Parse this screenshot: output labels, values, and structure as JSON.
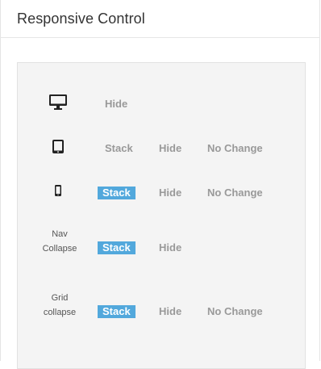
{
  "header": {
    "title": "Responsive Control"
  },
  "colors": {
    "active_option": "#52a8dc",
    "inactive_option_text": "#999999",
    "panel_background": "#f4f4f4",
    "icon": "#222222"
  },
  "rows": [
    {
      "device": "desktop-icon",
      "options": [
        {
          "label": "Hide",
          "active": false
        }
      ]
    },
    {
      "device": "tablet-icon",
      "options": [
        {
          "label": "Stack",
          "active": false
        },
        {
          "label": "Hide",
          "active": false
        },
        {
          "label": "No Change",
          "active": false
        }
      ]
    },
    {
      "device": "phone-icon",
      "options": [
        {
          "label": "Stack",
          "active": true
        },
        {
          "label": "Hide",
          "active": false
        },
        {
          "label": "No Change",
          "active": false
        }
      ]
    },
    {
      "label_line1": "Nav",
      "label_line2": "Collapse",
      "options": [
        {
          "label": "Stack",
          "active": true
        },
        {
          "label": "Hide",
          "active": false
        }
      ]
    },
    {
      "label_line1": "Grid",
      "label_line2": "collapse",
      "options": [
        {
          "label": "Stack",
          "active": true
        },
        {
          "label": "Hide",
          "active": false
        },
        {
          "label": "No Change",
          "active": false
        }
      ]
    }
  ]
}
